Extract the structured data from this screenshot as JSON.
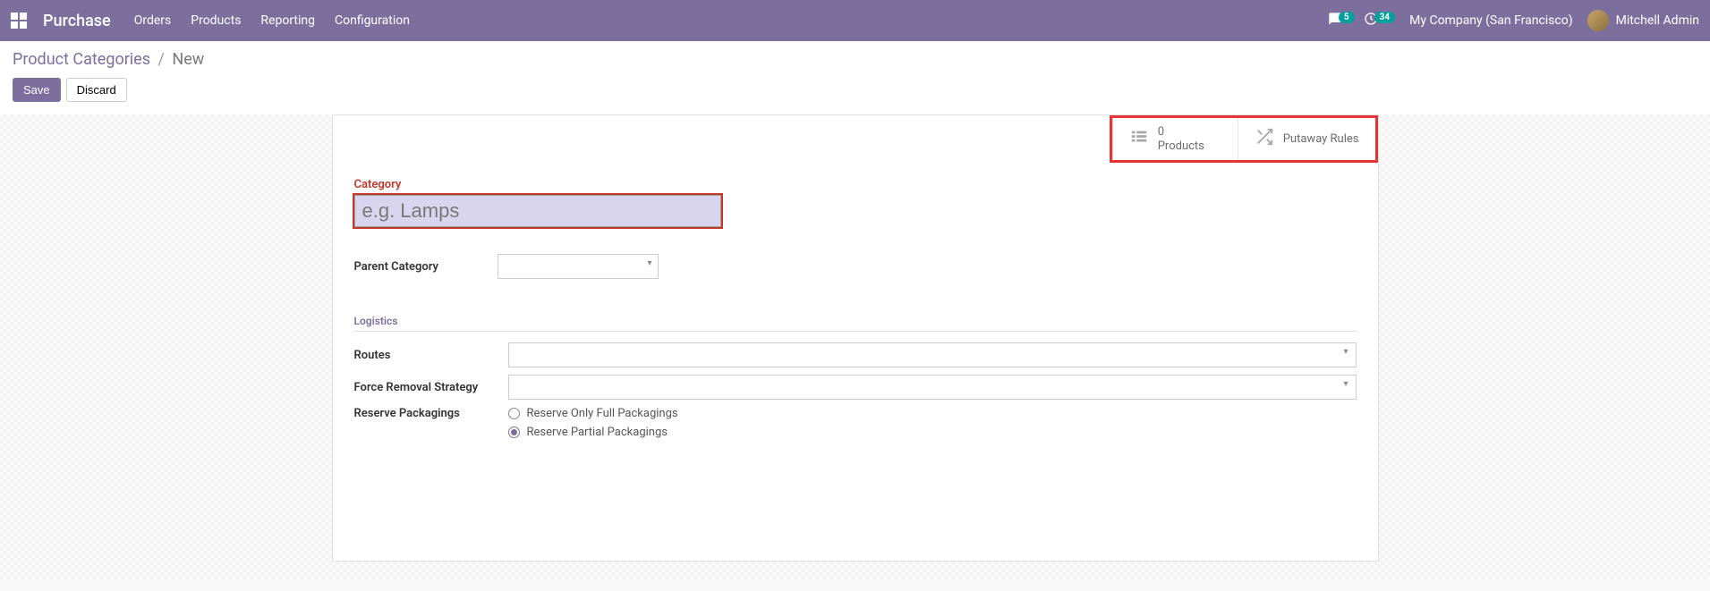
{
  "topbar": {
    "app_name": "Purchase",
    "nav": {
      "orders": "Orders",
      "products": "Products",
      "reporting": "Reporting",
      "configuration": "Configuration"
    },
    "messages_count": "5",
    "activities_count": "34",
    "company": "My Company (San Francisco)",
    "user": "Mitchell Admin"
  },
  "breadcrumb": {
    "parent": "Product Categories",
    "current": "New"
  },
  "actions": {
    "save": "Save",
    "discard": "Discard"
  },
  "smart_buttons": {
    "products_count": "0",
    "products_label": "Products",
    "putaway_label": "Putaway Rules"
  },
  "form": {
    "category_label": "Category",
    "category_placeholder": "e.g. Lamps",
    "parent_category_label": "Parent Category",
    "logistics_section": "Logistics",
    "routes_label": "Routes",
    "force_removal_label": "Force Removal Strategy",
    "reserve_packagings_label": "Reserve Packagings",
    "reserve_full": "Reserve Only Full Packagings",
    "reserve_partial": "Reserve Partial Packagings"
  }
}
